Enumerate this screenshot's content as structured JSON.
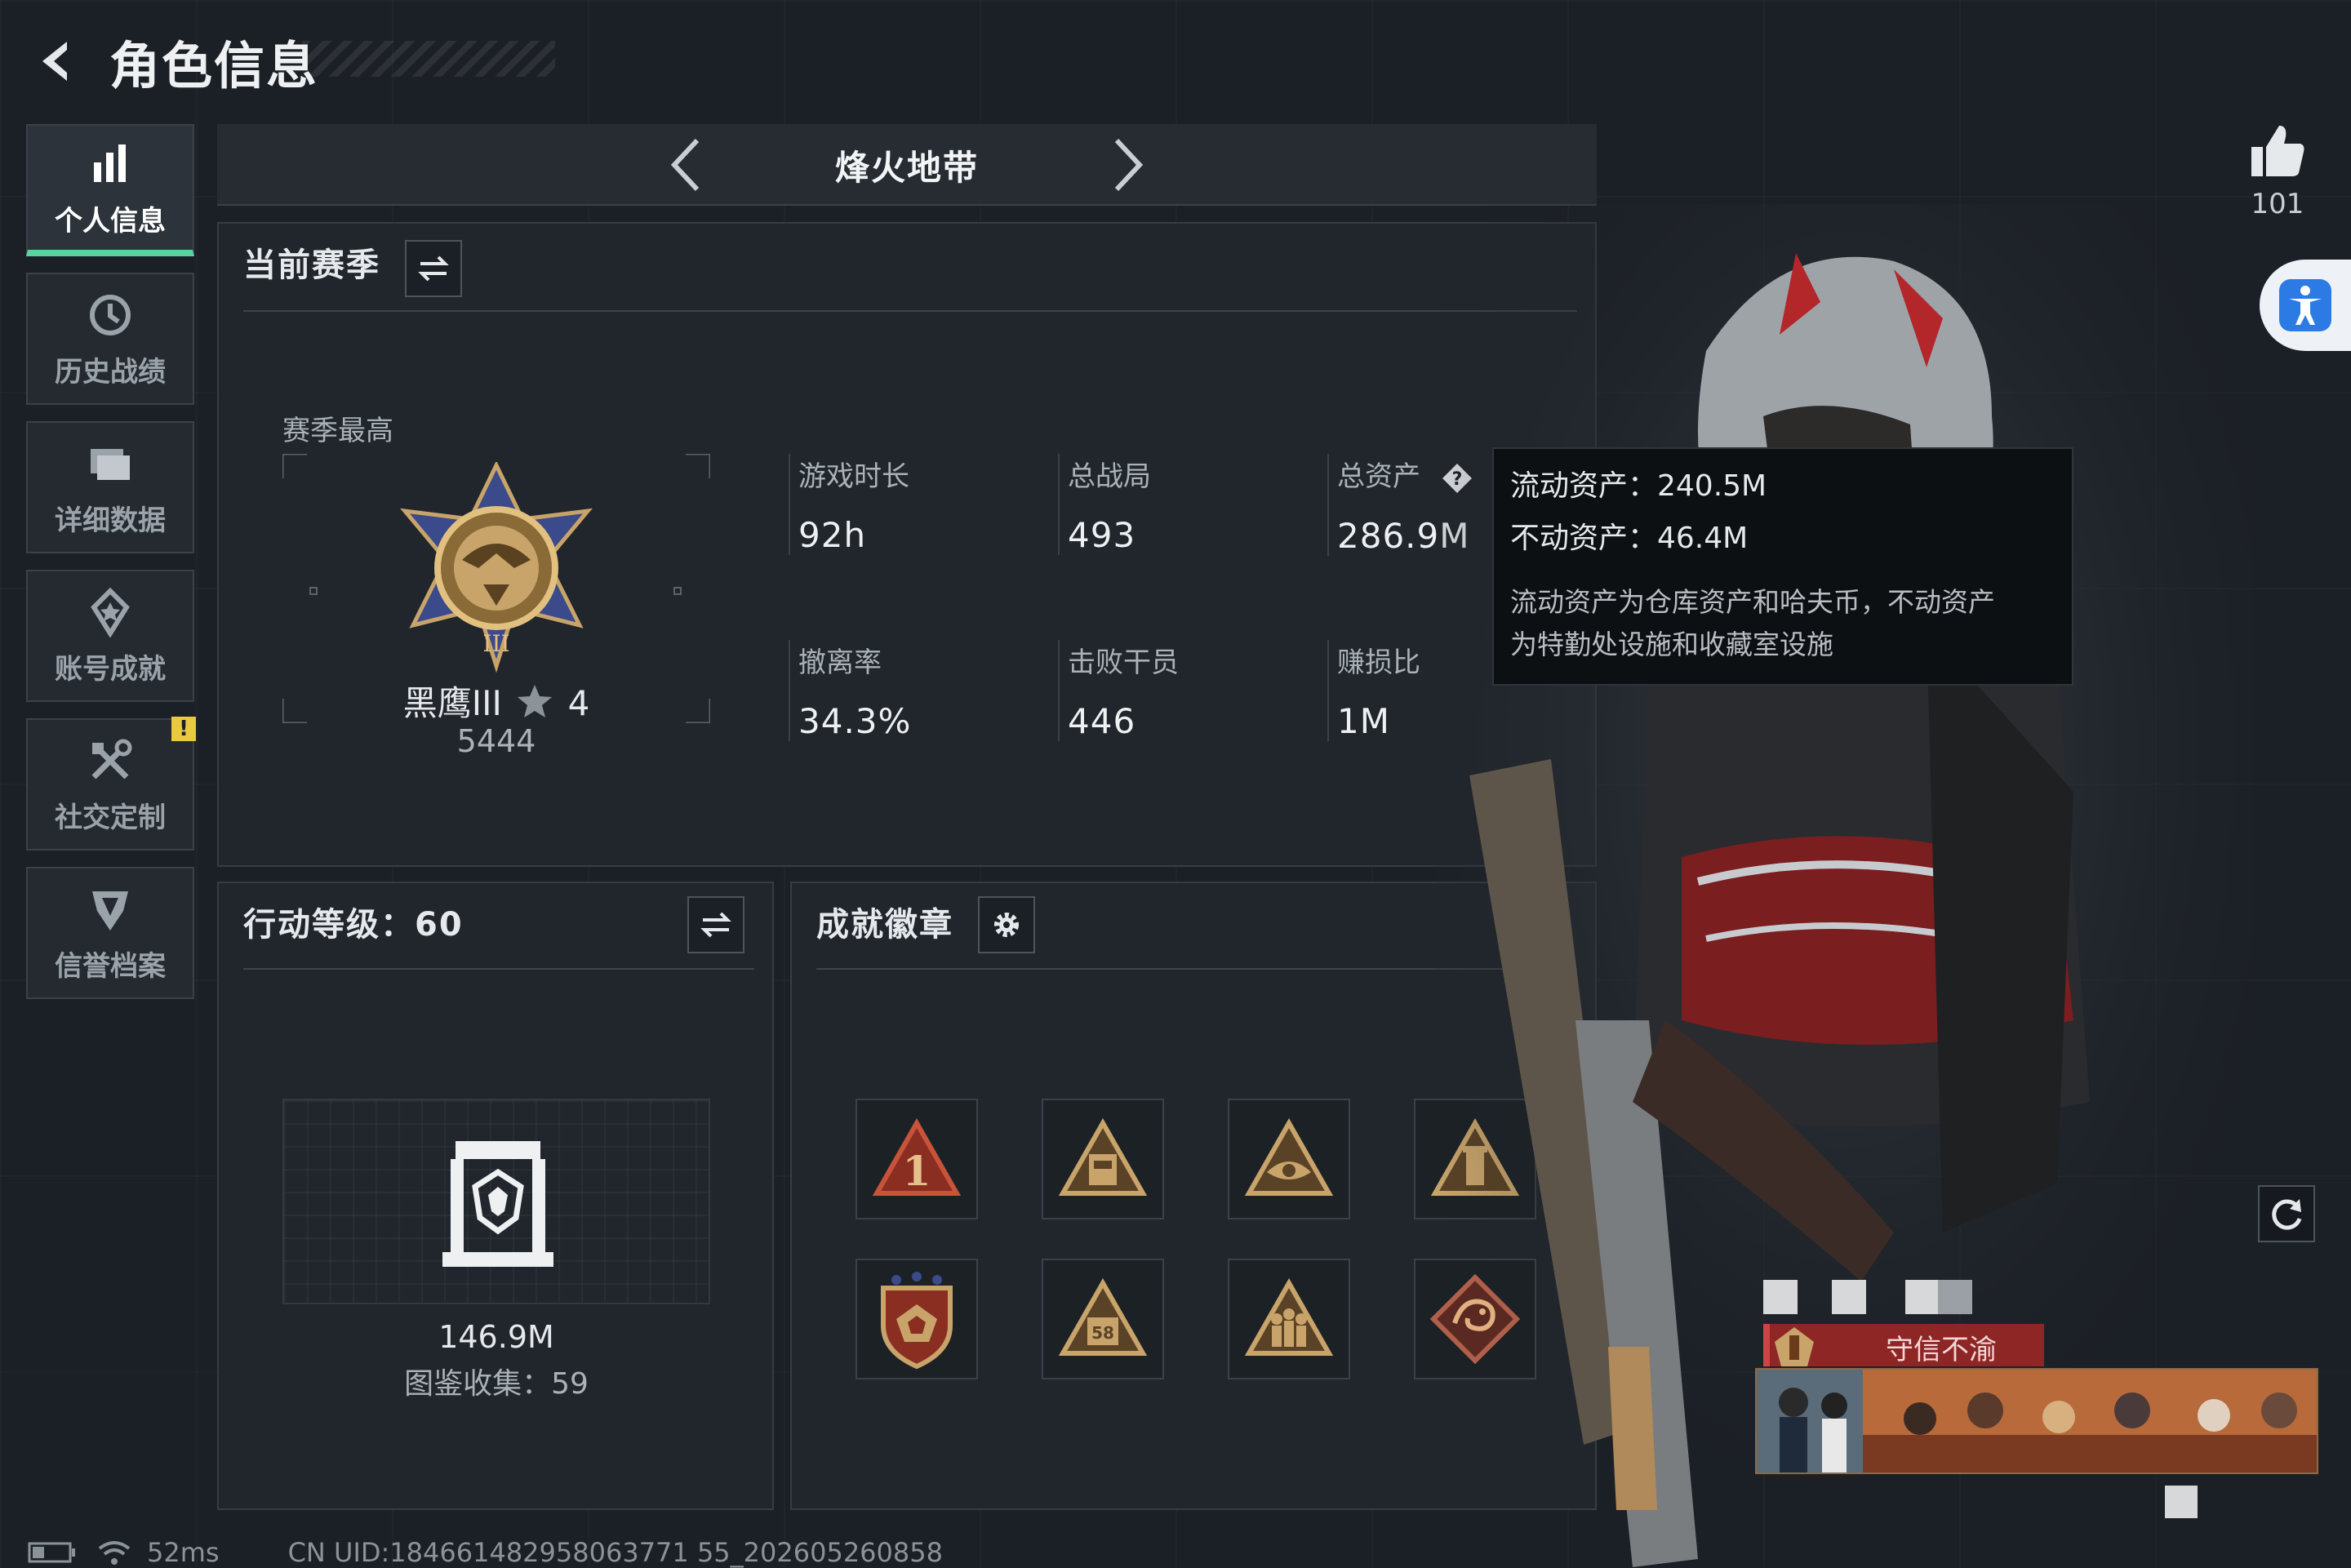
{
  "header": {
    "title": "角色信息",
    "back_icon": "back-arrow-icon"
  },
  "sidebar": {
    "items": [
      {
        "label": "个人信息",
        "icon": "bar-chart-icon",
        "active": true
      },
      {
        "label": "历史战绩",
        "icon": "history-clock-icon",
        "active": false
      },
      {
        "label": "详细数据",
        "icon": "folder-icon",
        "active": false
      },
      {
        "label": "账号成就",
        "icon": "achievement-icon",
        "active": false
      },
      {
        "label": "社交定制",
        "icon": "tools-icon",
        "active": false,
        "badge": "!"
      },
      {
        "label": "信誉档案",
        "icon": "shield-icon",
        "active": false
      }
    ]
  },
  "mode": {
    "title": "烽火地带"
  },
  "season": {
    "title": "当前赛季",
    "best_label": "赛季最高",
    "rank_name": "黑鹰III",
    "rank_stars": "4",
    "rank_score": "5444",
    "stats": [
      {
        "label": "游戏时长",
        "value": "92h"
      },
      {
        "label": "总战局",
        "value": "493"
      },
      {
        "label": "总资产",
        "value": "286.9M"
      },
      {
        "label": "撤离率",
        "value": "34.3%"
      },
      {
        "label": "击败干员",
        "value": "446"
      },
      {
        "label": "赚损比",
        "value": "1M"
      }
    ]
  },
  "tooltip": {
    "liquid": "流动资产：240.5M",
    "fixed": "不动资产：46.4M",
    "desc_line1": "流动资产为仓库资产和哈夫币，不动资产",
    "desc_line2": "为特勤处设施和收藏室设施"
  },
  "level": {
    "title": "行动等级：60",
    "asset": "146.9M",
    "collection": "图鉴收集：59"
  },
  "badges": {
    "title": "成就徽章",
    "items": [
      {
        "icon": "badge-number-one-icon",
        "color": "#c9533a"
      },
      {
        "icon": "badge-building-icon",
        "color": "#c8a46a"
      },
      {
        "icon": "badge-eye-icon",
        "color": "#c8a46a"
      },
      {
        "icon": "badge-tower-icon",
        "color": "#c8a46a"
      },
      {
        "icon": "badge-shield-stars-icon",
        "color": "#c9533a"
      },
      {
        "icon": "badge-58-icon",
        "color": "#c8a46a"
      },
      {
        "icon": "badge-soldiers-icon",
        "color": "#c8a46a"
      },
      {
        "icon": "badge-dragon-icon",
        "color": "#b0604a"
      }
    ]
  },
  "profile": {
    "likes": "101",
    "title_tag": "守信不渝"
  },
  "status": {
    "ping": "52ms",
    "uid": "CN UID:184661482958063771 55_202605260858"
  },
  "colors": {
    "accent": "#5ad3a0",
    "badge_gold": "#c8a46a",
    "badge_red": "#c9533a",
    "tag_red": "#8f2626"
  }
}
